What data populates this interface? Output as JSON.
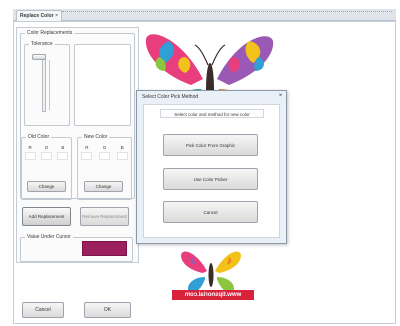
{
  "window": {
    "tab_title": "Replace Color",
    "tab_close": "×"
  },
  "left": {
    "color_replacements_label": "Color Replacements",
    "tolerance_label": "Tolerance",
    "old_color_label": "Old Color",
    "new_color_label": "New Color",
    "channels": [
      "R",
      "G",
      "B"
    ],
    "change_label": "Change",
    "add_replacement_label": "Add Replacement",
    "remove_replacement_label": "Remove Replacement",
    "value_under_cursor_label": "Value Under Cursor",
    "cursor_color": "#9c1f5e"
  },
  "footer": {
    "cancel_label": "Cancel",
    "ok_label": "OK"
  },
  "canvas": {
    "banner_text": "www.tipsnorial.com",
    "banner_color": "#d6223b"
  },
  "dialog": {
    "title": "Select Color Pick Method",
    "close": "×",
    "prompt": "Select color and method for new color",
    "pick_label": "Pick Color From Graphic",
    "color_picker_label": "Use Color Picker",
    "cancel_label": "Cancel"
  }
}
